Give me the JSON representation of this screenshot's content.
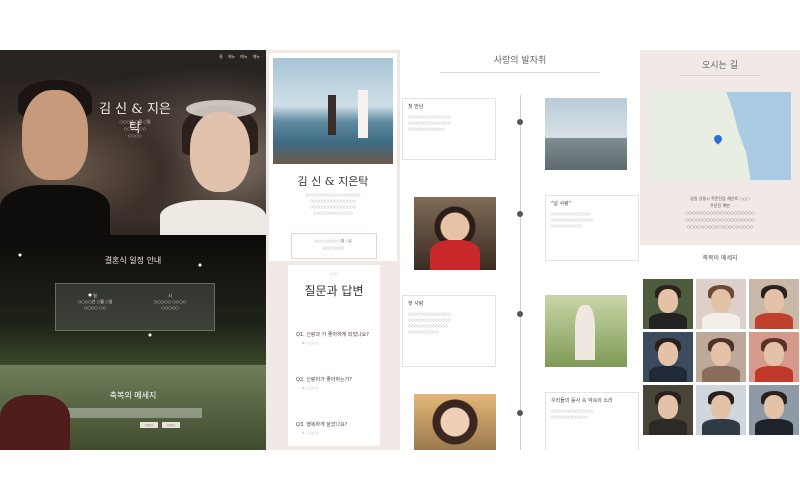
{
  "panel1": {
    "nav": [
      "홈",
      "메뉴",
      "메뉴",
      "메뉴"
    ],
    "title": "김 신 & 지은탁",
    "subtitle_lines": [
      "○○○년 ○월 ○일",
      "○○○○ ○○",
      "○○○○"
    ],
    "section_title": "결혼식 일정 안내",
    "info_left_title": "일",
    "info_right_title": "시",
    "info_left_lines": [
      "○○○○년 ○월 ○일",
      "○○○○ ○○"
    ],
    "info_right_lines": [
      "○○○○○ ○○○○",
      "○○○○○"
    ],
    "garden_title": "축복의 메세지",
    "btn1": "○○○",
    "btn2": "○○○"
  },
  "panel2": {
    "title": "김 신 & 지은탁",
    "intro_lines": [
      "○○○○○○○○○○○○○○○○○○",
      "○○○○○○○○○○○○○○○",
      "○○○○○○○○○○○○○○○",
      "○○○○○○○○○○○○○"
    ],
    "date_line1": "○○○ ○○○○ ○월 ○일",
    "date_line2": "○○○ ○○○○",
    "qa_caption": "○○○",
    "qa_title": "질문과 답변",
    "qa": [
      {
        "q": "Q1. 신랑과 가 좋아하게 되었나요?",
        "s": "A. ○○○○"
      },
      {
        "q": "Q2. 신랑이가 좋아하는가?",
        "s": "A. ○○○○"
      },
      {
        "q": "Q3. 행복하게 살았나요?",
        "s": "A. ○○○○"
      }
    ]
  },
  "panel3": {
    "title": "사랑의 발자취",
    "items": [
      {
        "h": "첫 만남",
        "lines": [
          "○○○○○○○○○○○○○○",
          "○○○○○○○○○○○○○○",
          "○○○○○○○○○○○○"
        ]
      },
      {
        "h": "\"널 사랑\"",
        "lines": [
          "○○○○○○○○○○○○○",
          "○○○○○○○○○○○○○○",
          "○○○○○○○○○○"
        ]
      },
      {
        "h": "첫 사랑",
        "lines": [
          "○○○○○○○○○○○○○○",
          "○○○○○○○○○○○○○○",
          "○○○○○○○○○○○○○",
          "○○○○○○○○○○"
        ]
      },
      {
        "h": "우리들의 동사 속 약속의 소리",
        "lines": [
          "○○○○○○○○○○○○○○",
          "○○○○○○○○○○○○"
        ]
      }
    ]
  },
  "panel4": {
    "title": "오시는 길",
    "address_lines": [
      "강원 강릉시 주문진읍 해안로 ○○○",
      "주문진 해변",
      "○○○○○○○○○○○○○○○○○○○○",
      "○○○○○○○○○○○○○○○○○○○○",
      "○○○○○○○○○○○○○○○○○○○"
    ],
    "blessing_title": "축복의 메세지"
  },
  "colors": {
    "accent_pink": "#f0e8e4",
    "dark": "#1c1917"
  }
}
